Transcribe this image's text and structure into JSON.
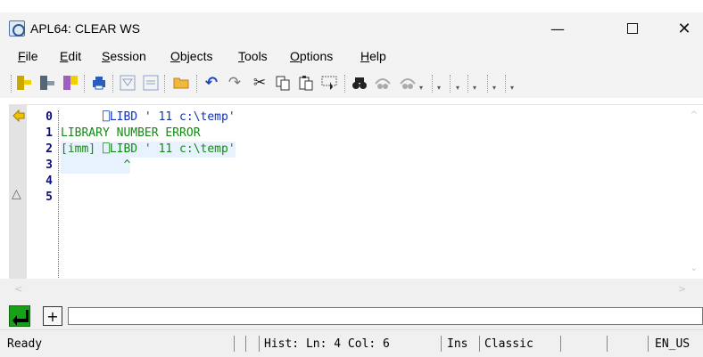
{
  "title": "APL64: CLEAR WS",
  "menu": [
    "File",
    "Edit",
    "Session",
    "Objects",
    "Tools",
    "Options",
    "Help"
  ],
  "editor": {
    "line_numbers": [
      "0",
      "1",
      "2",
      "3",
      "4",
      "5"
    ],
    "lines": [
      {
        "text": "      ⎕LIBD ' 11 c:\\temp'"
      },
      {
        "text": "LIBRARY NUMBER ERROR"
      },
      {
        "text": "[imm] ⎕LIBD ' 11 c:\\temp'"
      },
      {
        "text": "         ^"
      }
    ]
  },
  "status": {
    "ready": "Ready",
    "hist": "Hist: Ln: 4 Col: 6",
    "ins": "Ins",
    "classic": "Classic",
    "locale": "EN_US"
  },
  "colors": {
    "titlebar": "#f3f3f3",
    "code_blue": "#1133bb",
    "code_green": "#138a13",
    "line_number": "#0d0d7a",
    "enter_button": "#18a018"
  }
}
